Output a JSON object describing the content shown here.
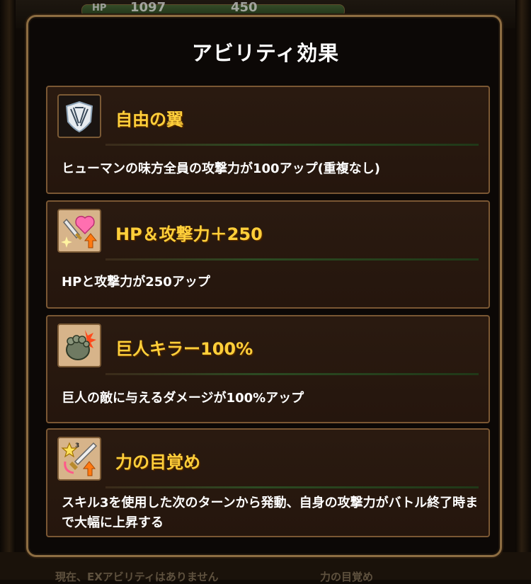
{
  "background": {
    "hp_label": "HP",
    "hp_value": "1097",
    "atk_value": "450",
    "bottom_left_text": "現在、EXアビリティはありません",
    "bottom_right_text": "力の目覚め"
  },
  "modal": {
    "title": "アビリティ効果",
    "abilities": [
      {
        "icon": "wings-emblem-icon",
        "name": "自由の翼",
        "description": "ヒューマンの味方全員の攻撃力が100アップ(重複なし)"
      },
      {
        "icon": "sword-heart-up-icon",
        "name": "HP＆攻撃力＋250",
        "description": "HPと攻撃力が250アップ"
      },
      {
        "icon": "giant-fist-icon",
        "name": "巨人キラー100%",
        "description": "巨人の敵に与えるダメージが100%アップ"
      },
      {
        "icon": "skill3-sword-up-icon",
        "name": "力の目覚め",
        "description": "スキル3を使用した次のターンから発動、自身の攻撃力がバトル終了時まで大幅に上昇する"
      }
    ]
  },
  "colors": {
    "title_gold": "#ffcf3a",
    "card_border": "#7a5733",
    "card_bg": "#25160d",
    "divider_green": "#2c4a22"
  }
}
